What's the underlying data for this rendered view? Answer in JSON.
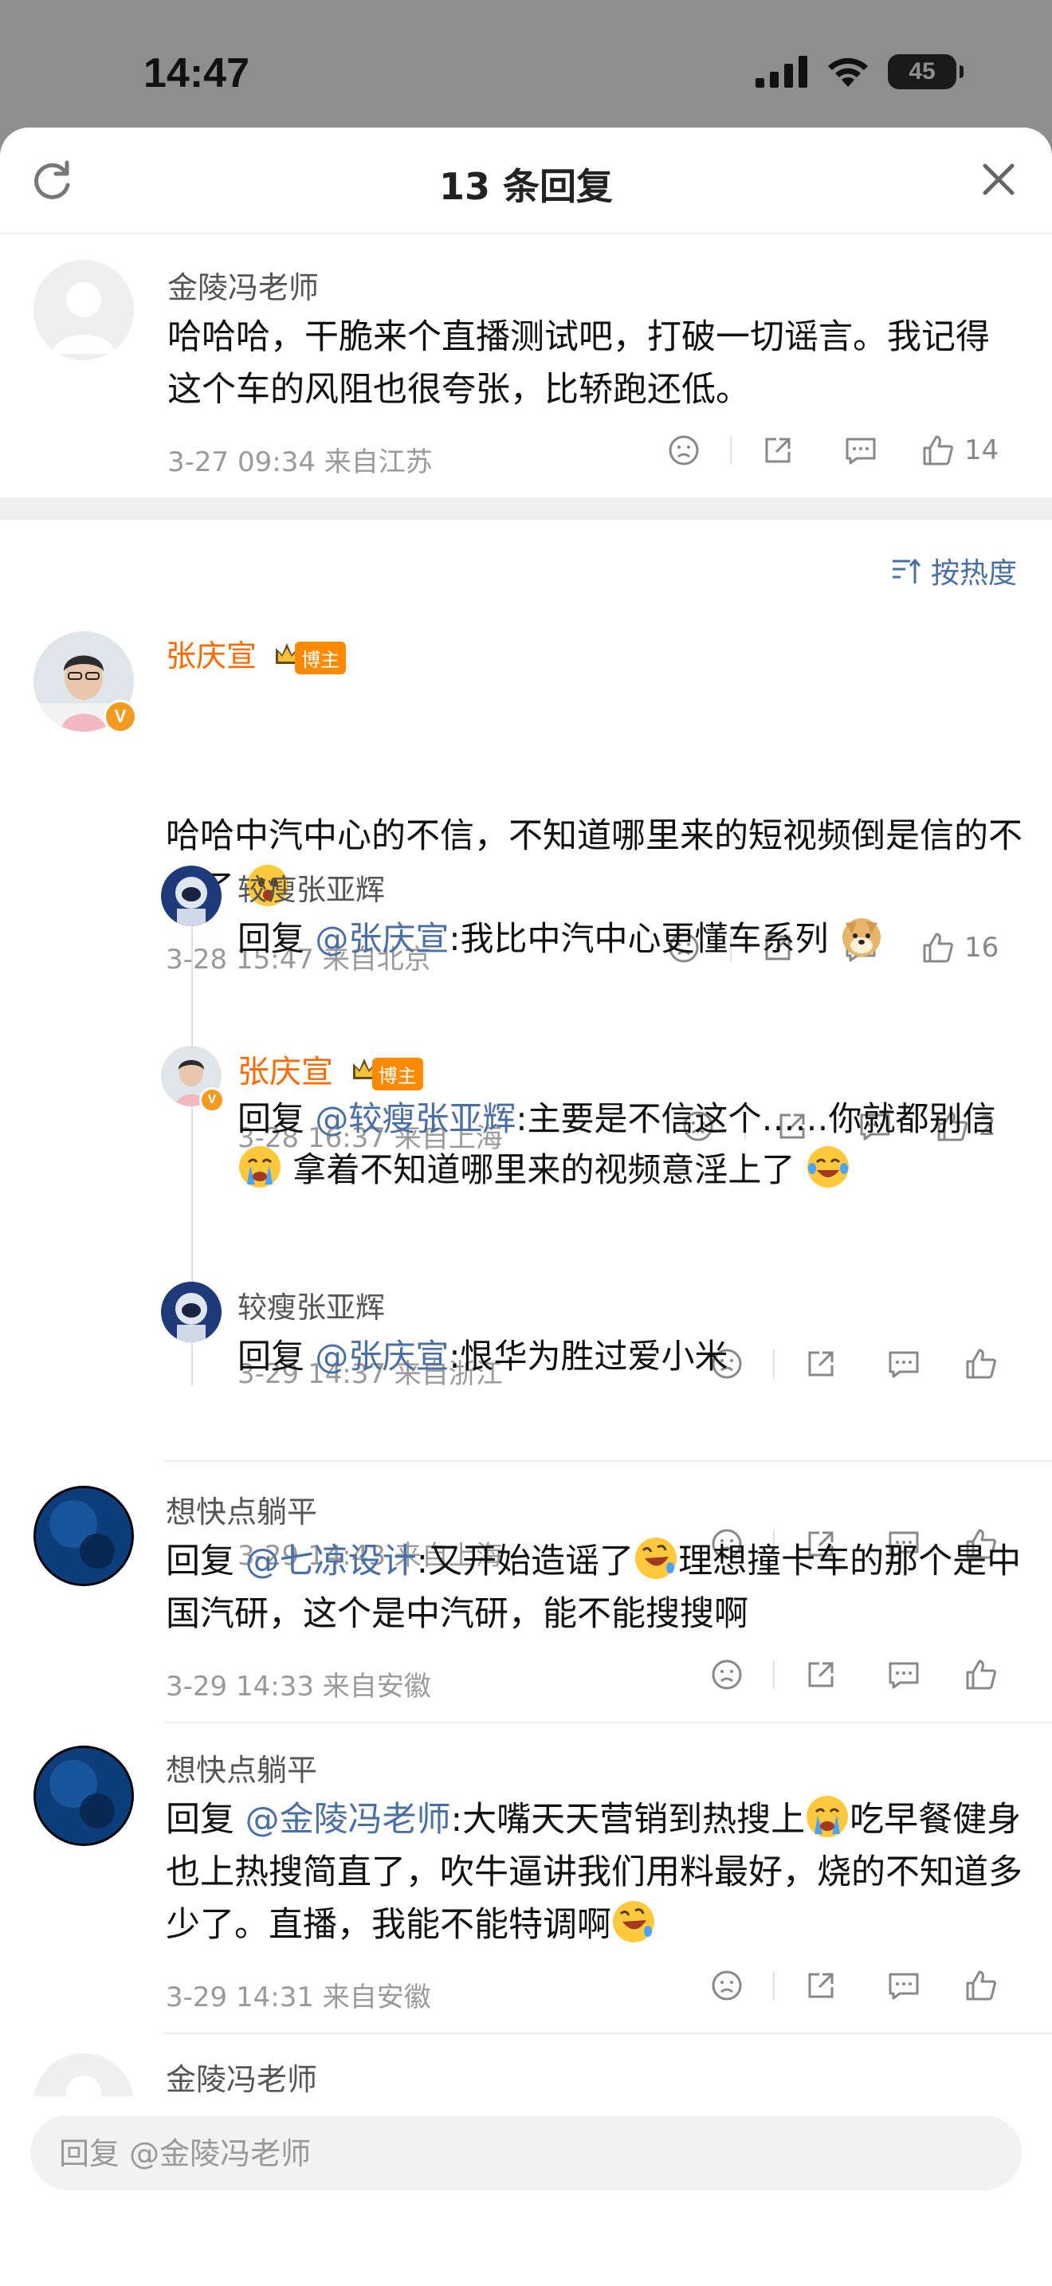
{
  "status": {
    "time": "14:47",
    "battery": "45"
  },
  "header": {
    "title": "13 条回复"
  },
  "root": {
    "username": "金陵冯老师",
    "text": "哈哈哈，干脆来个直播测试吧，打破一切谣言。我记得这个车的风阻也很夸张，比轿跑还低。",
    "meta": "3-27 09:34  来自江苏",
    "likes": "14"
  },
  "sort": {
    "label": "按热度"
  },
  "thread": {
    "username": "张庆宣",
    "badge": "博主",
    "text": "哈哈中汽中心的不信，不知道哪里来的短视频倒是信的不得了",
    "meta": "3-28 15:47  来自北京",
    "likes": "16",
    "replies": [
      {
        "username": "较瘦张亚辉",
        "prefix": "回复 ",
        "mention": "@张庆宣",
        "text": ":我比中汽中心更懂车系列",
        "meta": "3-28 16:37  来自上海",
        "likes": "2"
      },
      {
        "username": "张庆宣",
        "badge": "博主",
        "prefix": "回复 ",
        "mention": "@较瘦张亚辉",
        "text": ":主要是不信这个……你就都别信",
        "text2": "拿着不知道哪里来的视频意淫上了",
        "meta": "3-29 14:37  来自浙江"
      },
      {
        "username": "较瘦张亚辉",
        "prefix": "回复 ",
        "mention": "@张庆宣",
        "text": ":恨华为胜过爱小米",
        "meta": "3-29 14:43  来自上海"
      }
    ]
  },
  "comments": [
    {
      "username": "想快点躺平",
      "prefix": "回复 ",
      "mention": "@七凉设计",
      "text": ":又开始造谣了",
      "text2": "理想撞卡车的那个是中国汽研，这个是中汽研，能不能搜搜啊",
      "meta": "3-29 14:33  来自安徽"
    },
    {
      "username": "想快点躺平",
      "prefix": "回复 ",
      "mention": "@金陵冯老师",
      "text": ":大嘴天天营销到热搜上",
      "text2": "吃早餐健身也上热搜简直了，吹牛逼讲我们用料最好，烧的不知道多少了。直播，我能不能特调啊",
      "meta": "3-29 14:31  来自安徽"
    },
    {
      "username": "金陵冯老师"
    }
  ],
  "input": {
    "placeholder": "回复 @金陵冯老师"
  },
  "colors": {
    "accent_orange": "#ff6a00",
    "link_blue": "#4a6fa5"
  }
}
